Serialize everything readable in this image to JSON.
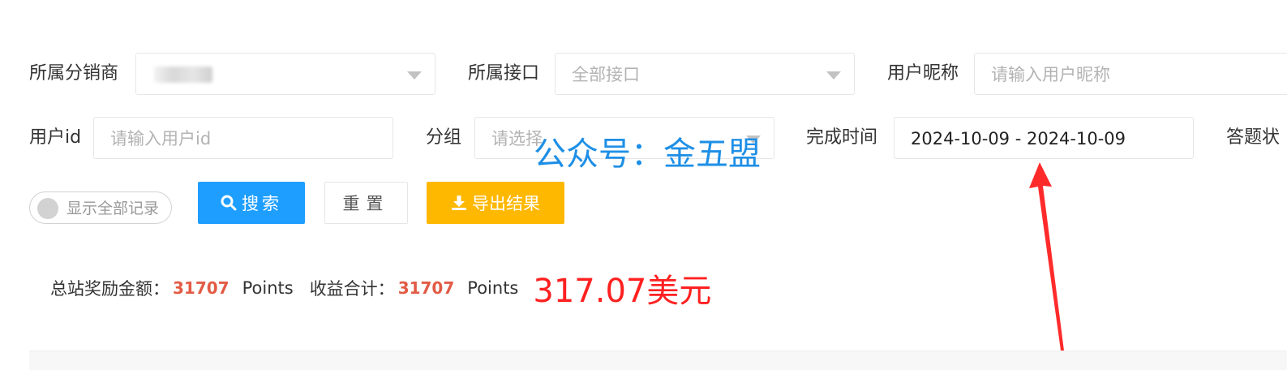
{
  "filters": {
    "distributor": {
      "label": "所属分销商"
    },
    "api": {
      "label": "所属接口",
      "value": "全部接口"
    },
    "nickname": {
      "label": "用户昵称",
      "placeholder": "请输入用户昵称"
    },
    "userid": {
      "label": "用户id",
      "placeholder": "请输入用户id"
    },
    "group": {
      "label": "分组",
      "placeholder": "请选择"
    },
    "complete_time": {
      "label": "完成时间",
      "value": "2024-10-09 - 2024-10-09"
    },
    "answer_status": {
      "label": "答题状"
    }
  },
  "toggle": {
    "label": "显示全部记录",
    "on": false
  },
  "buttons": {
    "search": "搜索",
    "reset": "重置",
    "export": "导出结果"
  },
  "summary": {
    "reward_label": "总站奖励金额：",
    "reward_value": "31707",
    "reward_unit": "Points",
    "income_label": "收益合计：",
    "income_value": "31707",
    "income_unit": "Points",
    "usd_note": "317.07美元"
  },
  "watermark": "公众号：金五盟",
  "colors": {
    "primary": "#1e9fff",
    "warm": "#ffb800",
    "accent_red": "#ff2020",
    "number_red": "#e25b45",
    "watermark_blue": "#1e8fe6",
    "arrow_red": "#ff2b2b"
  },
  "icons": {
    "search": "search-icon",
    "export": "download-icon",
    "dropdown": "chevron-down-icon"
  }
}
